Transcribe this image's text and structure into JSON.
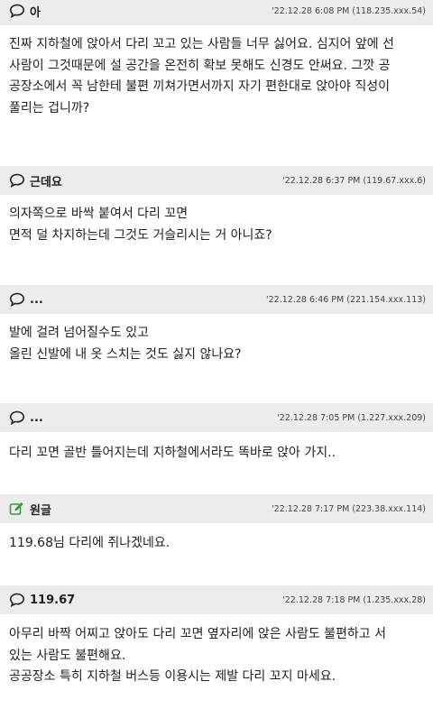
{
  "comments": [
    {
      "author": "아",
      "icon": "comment-icon",
      "meta": "'22.12.28 6:08 PM (118.235.xxx.54)",
      "lines": [
        "진짜 지하철에 앉아서 다리 꼬고 있는 사람들 너무 싫어요. 심지어 앞에 선",
        "사람이 그것때문에 설 공간을 온전히 확보 못해도 신경도 안써요. 그깟 공",
        "공장소에서 꼭 남한테 불편 끼쳐가면서까지 자기 편한대로 앉아야 직성이",
        "풀리는 겁니까?"
      ]
    },
    {
      "author": "근데요",
      "icon": "comment-icon",
      "meta": "'22.12.28 6:37 PM (119.67.xxx.6)",
      "lines": [
        "의자쪽으로 바싹 붙여서 다리 꼬면",
        "면적 덜 차지하는데 그것도 거슬리시는 거 아니죠?"
      ]
    },
    {
      "author": "...",
      "icon": "comment-icon",
      "meta": "'22.12.28 6:46 PM (221.154.xxx.113)",
      "lines": [
        "발에 걸려 넘어질수도 있고",
        "올린 신발에 내 옷 스치는 것도 싫지 않나요?"
      ]
    },
    {
      "author": "...",
      "icon": "comment-icon",
      "meta": "'22.12.28 7:05 PM (1.227.xxx.209)",
      "lines": [
        "다리 꼬면 골반 틀어지는데 지하철에서라도 똑바로 앉아 가지.."
      ]
    },
    {
      "author": "원글",
      "icon": "edit-icon",
      "meta": "'22.12.28 7:17 PM (223.38.xxx.114)",
      "lines": [
        "119.68님 다리에 쥐나겠네요."
      ]
    },
    {
      "author": "119.67",
      "icon": "comment-icon",
      "meta": "'22.12.28 7:18 PM (1.235.xxx.28)",
      "lines": [
        "아무리 바짝 어찌고 앉아도 다리 꼬면 옆자리에 앉은 사람도 불편하고 서",
        "있는 사람도 불편해요.",
        "공공장소 특히 지하철 버스등 이용시는 제발 다리 꼬지 마세요."
      ]
    }
  ],
  "colors": {
    "header_bg": "#ececec",
    "edit_icon": "#3a9a3a"
  }
}
